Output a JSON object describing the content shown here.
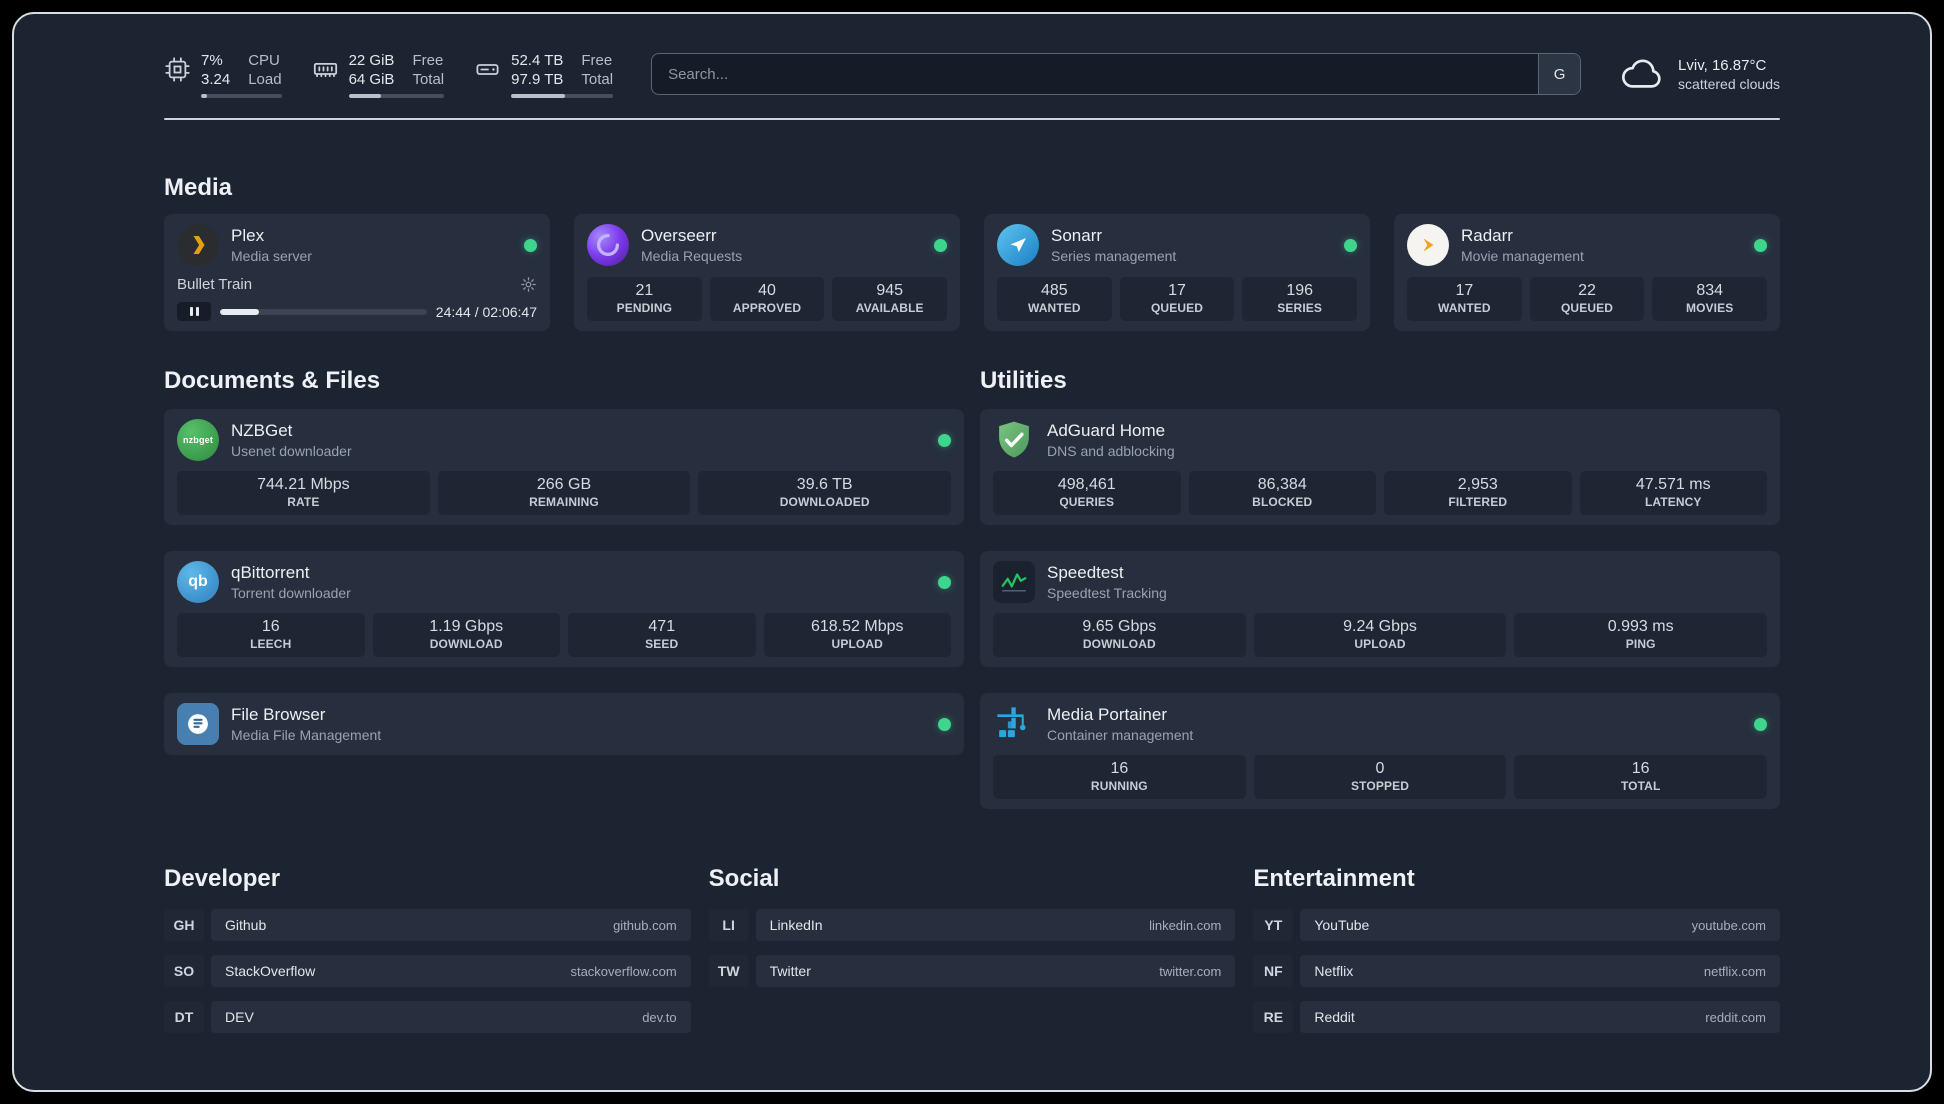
{
  "colors": {
    "status_green": "#3ed68e"
  },
  "topbar": {
    "cpu": {
      "line1": "7%",
      "label1": "CPU",
      "line2": "3.24",
      "label2": "Load",
      "progress": 8
    },
    "memory": {
      "line1": "22 GiB",
      "label1": "Free",
      "line2": "64 GiB",
      "label2": "Total",
      "progress": 34
    },
    "disk": {
      "line1": "52.4 TB",
      "label1": "Free",
      "line2": "97.9 TB",
      "label2": "Total",
      "progress": 53
    },
    "search": {
      "placeholder": "Search...",
      "provider_label": "G"
    },
    "weather": {
      "location": "Lviv, 16.87°C",
      "condition": "scattered clouds"
    }
  },
  "sections": {
    "media": {
      "title": "Media",
      "plex": {
        "name": "Plex",
        "description": "Media server",
        "player": {
          "track": "Bullet Train",
          "time": "24:44 / 02:06:47",
          "progress": 19
        }
      },
      "overseerr": {
        "name": "Overseerr",
        "description": "Media Requests",
        "stats": [
          {
            "value": "21",
            "label": "PENDING"
          },
          {
            "value": "40",
            "label": "APPROVED"
          },
          {
            "value": "945",
            "label": "AVAILABLE"
          }
        ]
      },
      "sonarr": {
        "name": "Sonarr",
        "description": "Series management",
        "stats": [
          {
            "value": "485",
            "label": "WANTED"
          },
          {
            "value": "17",
            "label": "QUEUED"
          },
          {
            "value": "196",
            "label": "SERIES"
          }
        ]
      },
      "radarr": {
        "name": "Radarr",
        "description": "Movie management",
        "stats": [
          {
            "value": "17",
            "label": "WANTED"
          },
          {
            "value": "22",
            "label": "QUEUED"
          },
          {
            "value": "834",
            "label": "MOVIES"
          }
        ]
      }
    },
    "documents": {
      "title": "Documents & Files",
      "nzbget": {
        "name": "NZBGet",
        "description": "Usenet downloader",
        "stats": [
          {
            "value": "744.21 Mbps",
            "label": "RATE"
          },
          {
            "value": "266 GB",
            "label": "REMAINING"
          },
          {
            "value": "39.6 TB",
            "label": "DOWNLOADED"
          }
        ]
      },
      "qbittorrent": {
        "name": "qBittorrent",
        "description": "Torrent downloader",
        "stats": [
          {
            "value": "16",
            "label": "LEECH"
          },
          {
            "value": "1.19 Gbps",
            "label": "DOWNLOAD"
          },
          {
            "value": "471",
            "label": "SEED"
          },
          {
            "value": "618.52 Mbps",
            "label": "UPLOAD"
          }
        ]
      },
      "filebrowser": {
        "name": "File Browser",
        "description": "Media File Management"
      }
    },
    "utilities": {
      "title": "Utilities",
      "adguard": {
        "name": "AdGuard Home",
        "description": "DNS and adblocking",
        "stats": [
          {
            "value": "498,461",
            "label": "QUERIES"
          },
          {
            "value": "86,384",
            "label": "BLOCKED"
          },
          {
            "value": "2,953",
            "label": "FILTERED"
          },
          {
            "value": "47.571 ms",
            "label": "LATENCY"
          }
        ]
      },
      "speedtest": {
        "name": "Speedtest",
        "description": "Speedtest Tracking",
        "stats": [
          {
            "value": "9.65 Gbps",
            "label": "DOWNLOAD"
          },
          {
            "value": "9.24 Gbps",
            "label": "UPLOAD"
          },
          {
            "value": "0.993 ms",
            "label": "PING"
          }
        ]
      },
      "portainer": {
        "name": "Media Portainer",
        "description": "Container management",
        "stats": [
          {
            "value": "16",
            "label": "RUNNING"
          },
          {
            "value": "0",
            "label": "STOPPED"
          },
          {
            "value": "16",
            "label": "TOTAL"
          }
        ]
      }
    },
    "bookmarks": {
      "developer": {
        "title": "Developer",
        "items": [
          {
            "abbr": "GH",
            "name": "Github",
            "url": "github.com"
          },
          {
            "abbr": "SO",
            "name": "StackOverflow",
            "url": "stackoverflow.com"
          },
          {
            "abbr": "DT",
            "name": "DEV",
            "url": "dev.to"
          }
        ]
      },
      "social": {
        "title": "Social",
        "items": [
          {
            "abbr": "LI",
            "name": "LinkedIn",
            "url": "linkedin.com"
          },
          {
            "abbr": "TW",
            "name": "Twitter",
            "url": "twitter.com"
          }
        ]
      },
      "entertainment": {
        "title": "Entertainment",
        "items": [
          {
            "abbr": "YT",
            "name": "YouTube",
            "url": "youtube.com"
          },
          {
            "abbr": "NF",
            "name": "Netflix",
            "url": "netflix.com"
          },
          {
            "abbr": "RE",
            "name": "Reddit",
            "url": "reddit.com"
          }
        ]
      }
    }
  }
}
